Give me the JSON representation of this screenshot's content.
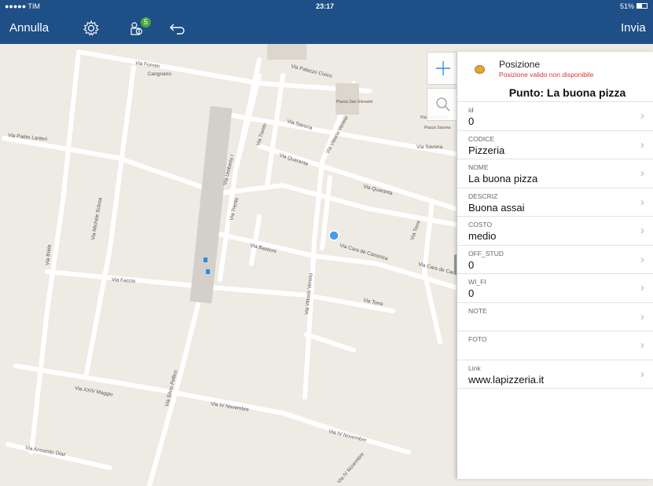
{
  "status": {
    "carrier": "●●●●● TIM",
    "time": "23:17",
    "battery": "51%"
  },
  "toolbar": {
    "cancel": "Annulla",
    "badge": "5",
    "send": "Invia"
  },
  "map": {
    "streets": [
      "Via Fornen",
      "Cangnano",
      "Via Palazzo Civico",
      "Piazza San Giovanni",
      "Piazza Savona",
      "Piazza Savona",
      "Via Savona",
      "Via Trento",
      "Via Savona",
      "Via Padre Lanteri",
      "Via Umberto I",
      "Via Quaranta",
      "Via Vittorio Veneto",
      "Via Quaranta",
      "Via Trento",
      "Via Michele Sclosa",
      "Via Brida",
      "Via Bastioni",
      "Via Cara de Canonica",
      "Via Torre",
      "Via Cara de Canonica",
      "Via Faccio",
      "Via Vittorio Veneto",
      "Via Torre",
      "Via XXIV Maggio",
      "Via Silvio Pellico",
      "Via IV Novembre",
      "Via IV Novembre",
      "Via Armando Diaz",
      "Via IV Novembre"
    ]
  },
  "panel": {
    "header_title": "Posizione",
    "header_sub": "Posizione valido non disponibile",
    "title": "Punto:  La buona pizza",
    "fields": [
      {
        "label": "id",
        "value": "0"
      },
      {
        "label": "CODICE",
        "value": "Pizzeria"
      },
      {
        "label": "NOME",
        "value": "La buona pizza"
      },
      {
        "label": "DESCRIZ",
        "value": "Buona assai"
      },
      {
        "label": "COSTO",
        "value": "medio"
      },
      {
        "label": "OFF_STUD",
        "value": "0"
      },
      {
        "label": "WI_FI",
        "value": "0"
      },
      {
        "label": "NOTE",
        "value": ""
      },
      {
        "label": "FOTO",
        "value": ""
      },
      {
        "label": "Link",
        "value": "www.lapizzeria.it"
      }
    ]
  }
}
